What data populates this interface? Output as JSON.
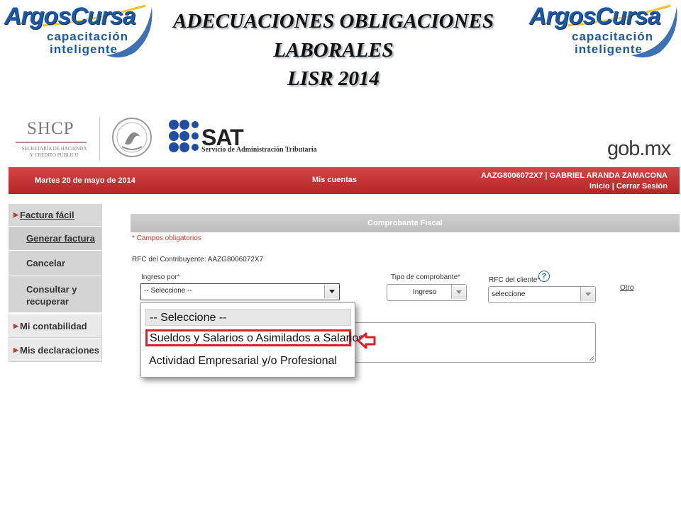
{
  "slide": {
    "title_line1": "ADECUACIONES OBLIGACIONES",
    "title_line2": "LABORALES",
    "title_line3": "LISR 2014",
    "logo_brand": "ArgosCursa",
    "logo_tag1": "capacitación",
    "logo_tag2": "inteligente"
  },
  "gov": {
    "shcp": "SHCP",
    "shcp_line1": "SECRETARÍA DE HACIENDA",
    "shcp_line2": "Y CRÉDITO PÚBLICO",
    "sat": "SAT",
    "sat_sub": "Servicio de Administración Tributaria",
    "gobmx": "gob.mx",
    "seal_icon": "mexico-seal-icon",
    "sat_logo_icon": "sat-dots-logo-icon"
  },
  "navbar": {
    "date": "Martes 20 de mayo de 2014",
    "section": "Mis cuentas",
    "user": "AAZG8006072X7 | GABRIEL ARANDA ZAMACONA",
    "inicio": "Inicio",
    "separator": "|",
    "cerrar": "Cerrar Sesión"
  },
  "sidebar": {
    "factura_facil": "Factura fácil",
    "generar_factura": "Generar factura",
    "cancelar": "Cancelar",
    "consultar_l1": "Consultar y",
    "consultar_l2": "recuperar",
    "mi_contabilidad": "Mi contabilidad",
    "mis_declaraciones": "Mis declaraciones"
  },
  "form": {
    "header": "Comprobante Fiscal",
    "required_note": "* Campos obligatorios",
    "rfc_contribuyente": "RFC del Contribuyente: AAZG8006072X7",
    "ingreso_label": "Ingreso por",
    "ingreso_value": "-- Seleccione --",
    "tipo_label": "Tipo de comprobante",
    "tipo_value": "Ingreso",
    "rfc_cliente_label": "RFC del cliente",
    "rfc_cliente_value": "seleccione",
    "help": "?",
    "otro": "Otro",
    "star": "*"
  },
  "dropdown": {
    "options": [
      "-- Seleccione --",
      "Sueldos y Salarios o Asimilados a Salarios",
      "Actividad Empresarial y/o Profesional"
    ],
    "highlight_color": "#e01c2b"
  },
  "colors": {
    "navbar_red": "#c33232",
    "brand_blue": "#1b58a6"
  }
}
